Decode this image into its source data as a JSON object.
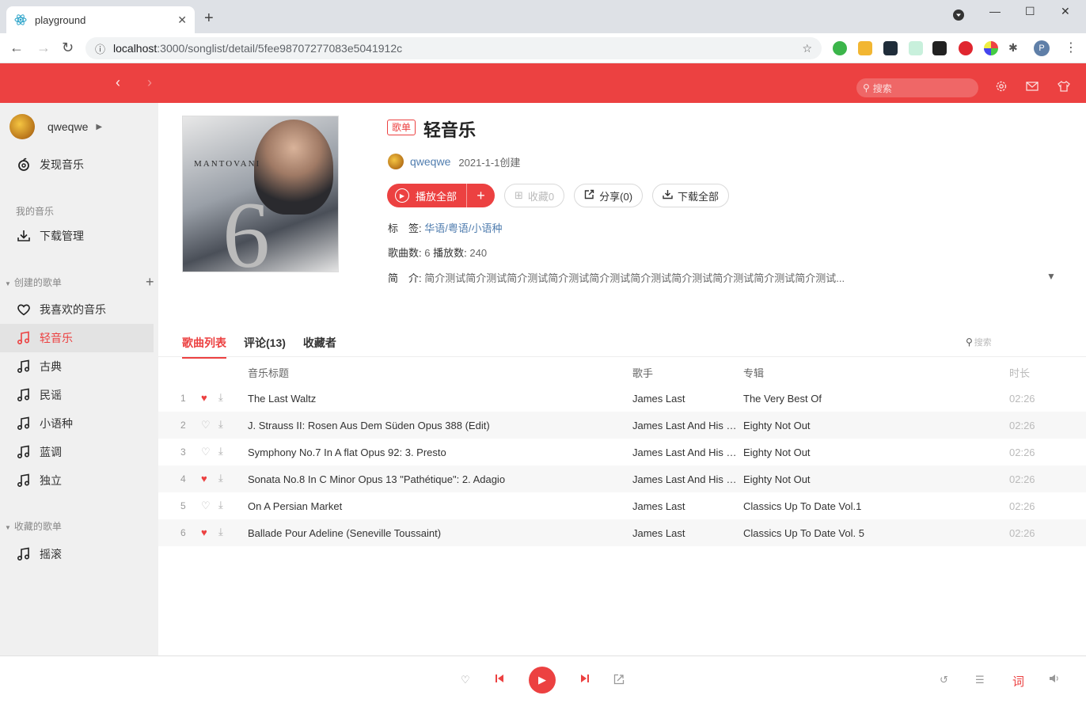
{
  "browser": {
    "tab_title": "playground",
    "url_host": "localhost",
    "url_path": ":3000/songlist/detail/5fee98707277083e5041912c"
  },
  "header": {
    "search_placeholder": "搜索"
  },
  "sidebar": {
    "username": "qweqwe",
    "discover": "发现音乐",
    "my_music_label": "我的音乐",
    "downloads": "下载管理",
    "created_label": "创建的歌单",
    "created_items": [
      {
        "label": "我喜欢的音乐",
        "icon": "heart-icon"
      },
      {
        "label": "轻音乐",
        "icon": "music-note-icon",
        "active": true
      },
      {
        "label": "古典",
        "icon": "music-note-icon"
      },
      {
        "label": "民谣",
        "icon": "music-note-icon"
      },
      {
        "label": "小语种",
        "icon": "music-note-icon"
      },
      {
        "label": "蓝调",
        "icon": "music-note-icon"
      },
      {
        "label": "独立",
        "icon": "music-note-icon"
      }
    ],
    "collected_label": "收藏的歌单",
    "collected_items": [
      {
        "label": "摇滚",
        "icon": "music-note-icon"
      }
    ]
  },
  "playlist": {
    "cover_text": "MANTOVANI",
    "tag": "歌单",
    "title": "轻音乐",
    "creator": "qweqwe",
    "created": "2021-1-1创建",
    "play_all": "播放全部",
    "collect": "收藏0",
    "share": "分享(0)",
    "download_all": "下载全部",
    "tags_label": "标　签:",
    "tags": "华语/粤语/小语种",
    "song_count_label": "歌曲数:",
    "song_count": "6",
    "play_count_label": "播放数:",
    "play_count": "240",
    "intro_label": "简　介:",
    "intro": "简介测试简介测试简介测试简介测试简介测试简介测试简介测试简介测试简介测试简介测试..."
  },
  "tabs": [
    {
      "label": "歌曲列表",
      "active": true
    },
    {
      "label": "评论(13)",
      "active": false
    },
    {
      "label": "收藏者",
      "active": false
    }
  ],
  "list_search_placeholder": "搜索",
  "columns": {
    "title": "音乐标题",
    "artist": "歌手",
    "album": "专辑",
    "duration": "时长"
  },
  "songs": [
    {
      "index": "1",
      "liked": true,
      "title": "The Last Waltz",
      "artist": "James Last",
      "album": "The Very Best Of",
      "duration": "02:26"
    },
    {
      "index": "2",
      "liked": false,
      "title": "J. Strauss II: Rosen Aus Dem Süden Opus 388 (Edit)",
      "artist": "James Last And His Orchestra",
      "album": "Eighty Not Out",
      "duration": "02:26"
    },
    {
      "index": "3",
      "liked": false,
      "title": "Symphony No.7 In A flat Opus 92: 3. Presto",
      "artist": "James Last And His Orchestra",
      "album": "Eighty Not Out",
      "duration": "02:26"
    },
    {
      "index": "4",
      "liked": true,
      "title": "Sonata No.8 In C Minor Opus 13 \"Pathétique\": 2. Adagio",
      "artist": "James Last And His Orchestra",
      "album": "Eighty Not Out",
      "duration": "02:26"
    },
    {
      "index": "5",
      "liked": false,
      "title": "On A Persian Market",
      "artist": "James Last",
      "album": "Classics Up To Date Vol.1",
      "duration": "02:26"
    },
    {
      "index": "6",
      "liked": true,
      "title": "Ballade Pour Adeline (Seneville Toussaint)",
      "artist": "James Last",
      "album": "Classics Up To Date Vol. 5",
      "duration": "02:26"
    }
  ],
  "player": {
    "lyric_label": "词"
  },
  "colors": {
    "brand": "#ec4141",
    "link": "#507daf"
  }
}
